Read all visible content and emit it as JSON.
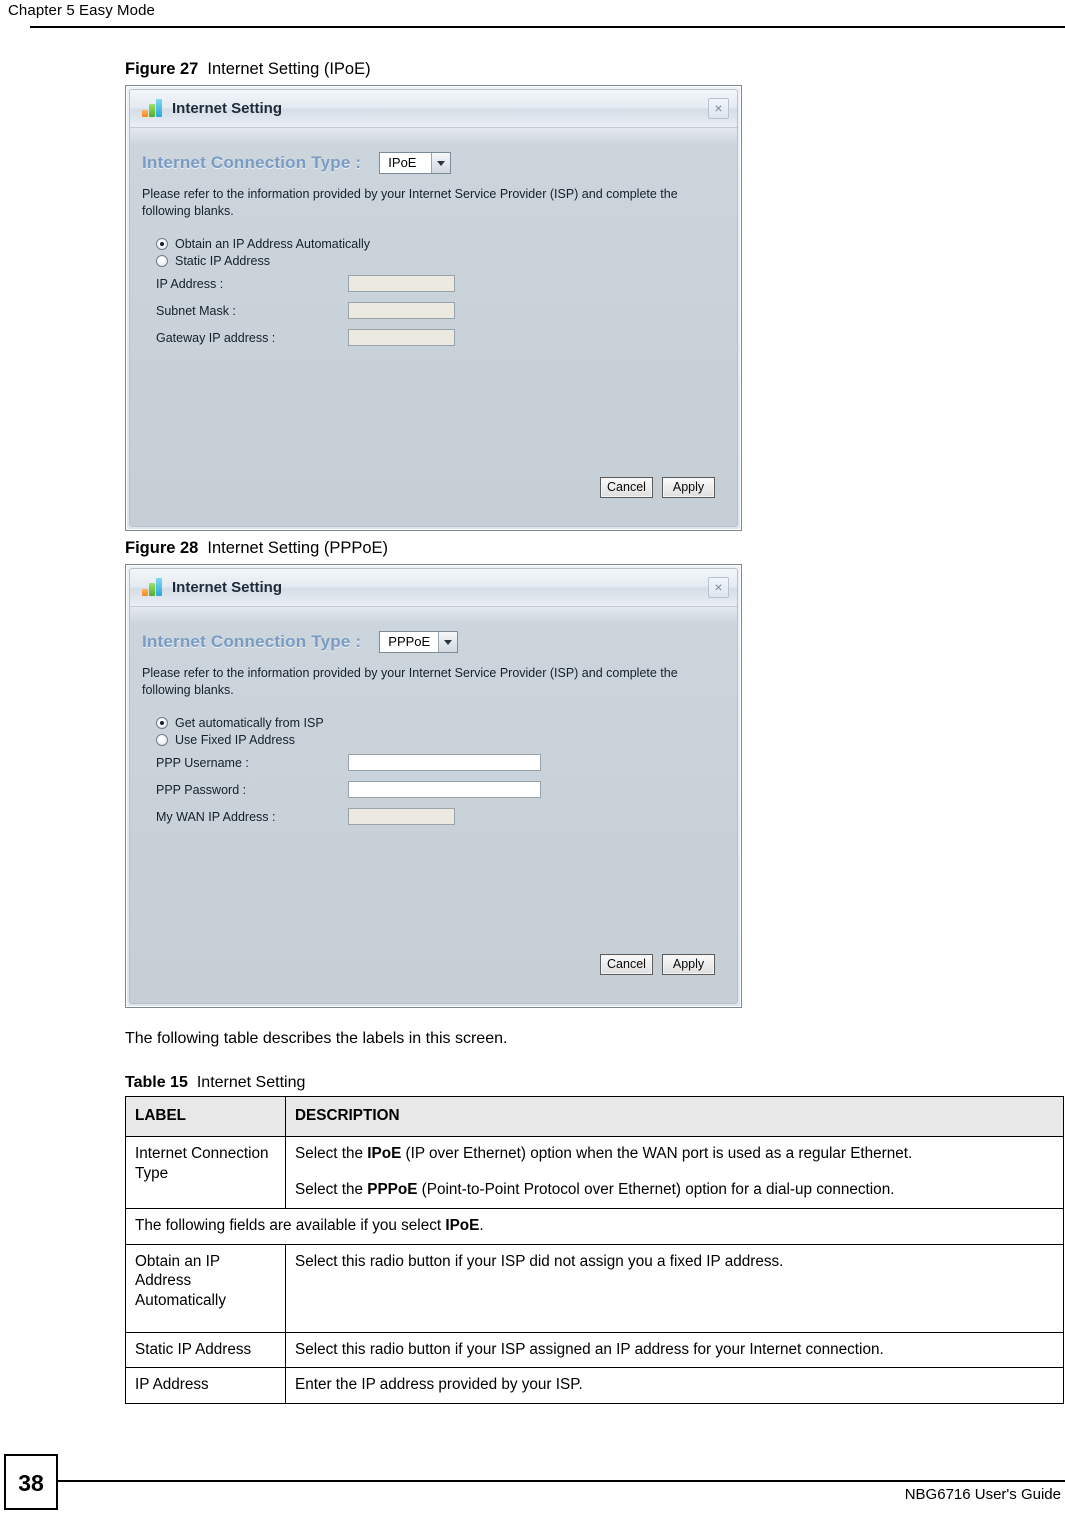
{
  "header": {
    "chapter": "Chapter 5 Easy Mode"
  },
  "figures": [
    {
      "number": "Figure 27",
      "title": "Internet Setting (IPoE)",
      "dialog": {
        "icon": "bar-chart-icon",
        "title": "Internet Setting",
        "close_label": "×",
        "connection_type_label": "Internet Connection Type :",
        "connection_type_value": "IPoE",
        "note": "Please refer to the information provided by your Internet Service Provider (ISP) and complete the following blanks.",
        "radios": [
          {
            "label": "Obtain an IP Address Automatically",
            "checked": true
          },
          {
            "label": "Static IP Address",
            "checked": false
          }
        ],
        "fields": [
          {
            "label": "IP Address :",
            "value": "",
            "width": "short"
          },
          {
            "label": "Subnet Mask :",
            "value": "",
            "width": "short"
          },
          {
            "label": "Gateway IP address :",
            "value": "",
            "width": "short"
          }
        ],
        "cancel_label": "Cancel",
        "apply_label": "Apply"
      }
    },
    {
      "number": "Figure 28",
      "title": "Internet Setting (PPPoE)",
      "dialog": {
        "icon": "bar-chart-icon",
        "title": "Internet Setting",
        "close_label": "×",
        "connection_type_label": "Internet Connection Type :",
        "connection_type_value": "PPPoE",
        "note": "Please refer to the information provided by your Internet Service Provider (ISP) and complete the following blanks.",
        "radios": [
          {
            "label": "Get automatically from ISP",
            "checked": true
          },
          {
            "label": "Use Fixed IP Address",
            "checked": false
          }
        ],
        "fields": [
          {
            "label": "PPP Username :",
            "value": "",
            "width": "long"
          },
          {
            "label": "PPP Password :",
            "value": "",
            "width": "long"
          },
          {
            "label": "My WAN IP Address :",
            "value": "",
            "width": "short"
          }
        ],
        "cancel_label": "Cancel",
        "apply_label": "Apply"
      }
    }
  ],
  "intro_text": "The following table describes the labels in this screen.",
  "table": {
    "caption_number": "Table 15",
    "caption_title": "Internet Setting",
    "columns": [
      "LABEL",
      "DESCRIPTION"
    ],
    "rows": [
      {
        "type": "normal",
        "label": "Internet Connection Type",
        "paragraphs": [
          "Select the IPoE (IP over Ethernet) option when the WAN port is used as a regular Ethernet.",
          "Select the PPPoE (Point-to-Point Protocol over Ethernet) option for a dial-up connection."
        ]
      },
      {
        "type": "span",
        "text": "The following fields are available if you select IPoE."
      },
      {
        "type": "normal",
        "label": "Obtain an IP Address Automatically",
        "paragraphs": [
          "Select this radio button if your ISP did not assign you a fixed IP address."
        ]
      },
      {
        "type": "normal",
        "label": "Static IP Address",
        "paragraphs": [
          "Select this radio button if your ISP assigned an IP address for your Internet connection."
        ]
      },
      {
        "type": "normal",
        "label": "IP Address",
        "paragraphs": [
          "Enter the IP address provided by your ISP."
        ]
      }
    ]
  },
  "footer": {
    "page_number": "38",
    "guide": "NBG6716 User's Guide"
  }
}
